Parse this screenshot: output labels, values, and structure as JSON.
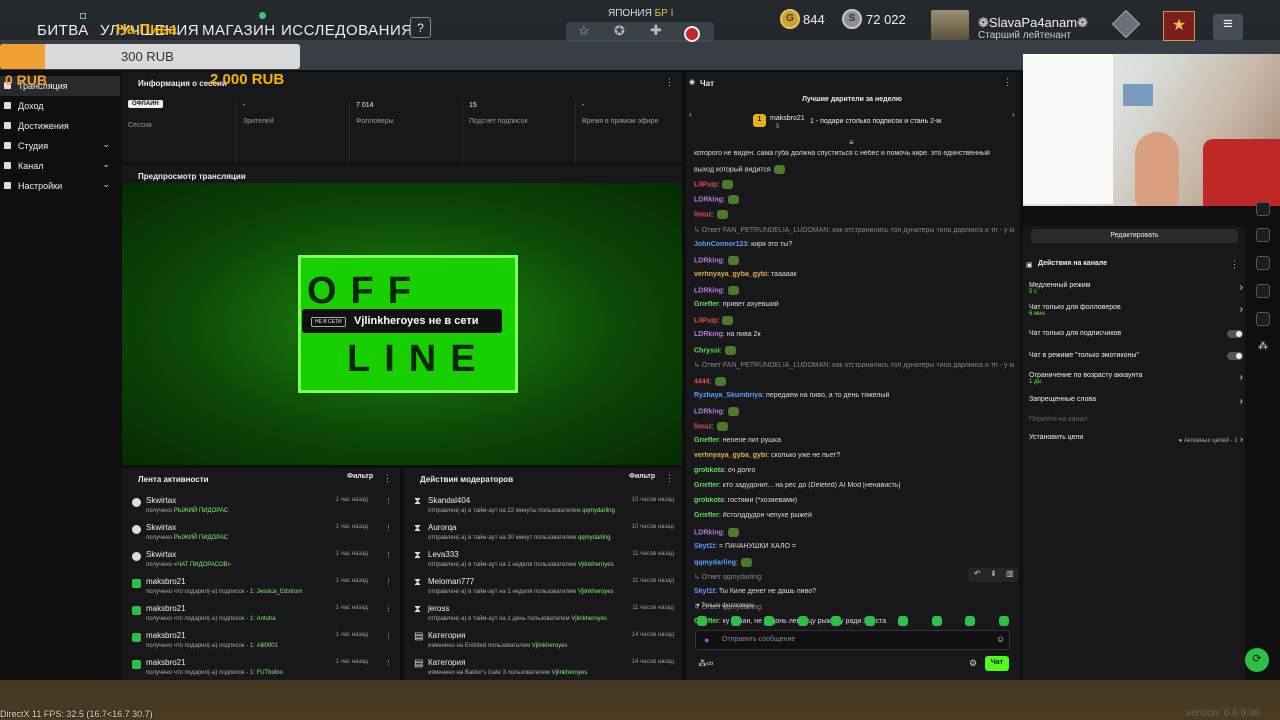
{
  "game": {
    "nav": [
      "БИТВА",
      "УЛУЧШЕНИЯ",
      "МАГАЗИН",
      "ИССЛЕДОВАНИЯ"
    ],
    "help": "?",
    "nation": "ЯПОНИЯ",
    "nation_tag": "БР І",
    "gold": "844",
    "silver": "72 022",
    "player": "❁SlavaPa4anam❁",
    "rank": "Старший лейтенант",
    "fps": "DirectX 11 FPS: 32.5 (16.7<16.7 30.7)",
    "version": "version: 0.6.9.98"
  },
  "donation": {
    "goal": "300 RUB",
    "current": "0 RUB",
    "overlay_title": "На Пива",
    "overlay_amount": "2 000 RUB",
    "progress": 0.0
  },
  "sidebar": {
    "items": [
      {
        "label": "Трансляция",
        "chev": false
      },
      {
        "label": "Доход",
        "chev": false
      },
      {
        "label": "Достижения",
        "chev": false
      },
      {
        "label": "Студия",
        "chev": true
      },
      {
        "label": "Канал",
        "chev": true
      },
      {
        "label": "Настройки",
        "chev": true
      }
    ]
  },
  "session": {
    "title": "Информация о сессии",
    "badge": "ОФЛАЙН",
    "stats": [
      {
        "value": "",
        "label": "Сессия"
      },
      {
        "value": "-",
        "label": "Зрителей"
      },
      {
        "value": "7 014",
        "label": "Фолловеры"
      },
      {
        "value": "15",
        "label": "Подсчет подписок"
      },
      {
        "value": "-",
        "label": "Время в прямом эфире"
      }
    ]
  },
  "preview": {
    "title": "Предпросмотр трансляции",
    "offline_top": "OFF",
    "offline_bottom": "LINE",
    "status_tag": "НЕ В СЕТИ",
    "status_text": "Vjlinkheroyes не в сети"
  },
  "activity": {
    "title": "Лента активности",
    "filter": "Фильтр",
    "rows": [
      {
        "name": "Skwirtax",
        "desc_a": "получено ",
        "desc_b": "РЫЖИЙ ПИДОРАС",
        "desc_c": "",
        "time": "1 час назад",
        "kind": "points"
      },
      {
        "name": "Skwirtax",
        "desc_a": "получено ",
        "desc_b": "РЫЖИЙ ПИДОРАС",
        "desc_c": "",
        "time": "1 час назад",
        "kind": "points"
      },
      {
        "name": "Skwirtax",
        "desc_a": "получено ",
        "desc_b": "«ЧАТ ПИДОРАСОВ»",
        "desc_c": "",
        "time": "1 час назад",
        "kind": "points"
      },
      {
        "name": "maksbro21",
        "desc_a": "получено что подарил(-а) подписок - ",
        "desc_b": "1",
        "desc_c": ": Jessica_Edstrom",
        "time": "1 час назад",
        "kind": "gift"
      },
      {
        "name": "maksbro21",
        "desc_a": "получено что подарил(-а) подписок - ",
        "desc_b": "1",
        "desc_c": ": Antuha",
        "time": "1 час назад",
        "kind": "gift"
      },
      {
        "name": "maksbro21",
        "desc_a": "получено что подарил(-а) подписок - ",
        "desc_b": "1",
        "desc_c": ": Alil0001",
        "time": "1 час назад",
        "kind": "gift"
      },
      {
        "name": "maksbro21",
        "desc_a": "получено что подарил(-а) подписок - ",
        "desc_b": "1",
        "desc_c": ": FUTbolno",
        "time": "1 час назад",
        "kind": "gift"
      }
    ]
  },
  "modactions": {
    "title": "Действия модераторов",
    "filter": "Фильтр",
    "rows": [
      {
        "name": "Skandal404",
        "desc_a": "отправлен(-а) в тайм-аут на 22 минуты пользователем ",
        "desc_b": "qqmydarling",
        "time": "10 часов назад",
        "kind": "timeout"
      },
      {
        "name": "Aurorqa",
        "desc_a": "отправлен(-а) в тайм-аут на 30 минут пользователем ",
        "desc_b": "qqmydarling",
        "time": "10 часов назад",
        "kind": "timeout"
      },
      {
        "name": "Leva333",
        "desc_a": "отправлен(-а) в тайм-аут на 1 неделя пользователем ",
        "desc_b": "Vjlinkheroyes",
        "time": "11 часов назад",
        "kind": "timeout"
      },
      {
        "name": "Meloman777",
        "desc_a": "отправлен(-а) в тайм-аут на 1 неделя пользователем ",
        "desc_b": "Vjlinkheroyes",
        "time": "11 часов назад",
        "kind": "timeout"
      },
      {
        "name": "jeross",
        "desc_a": "отправлен(-а) в тайм-аут на 1 день пользователем ",
        "desc_b": "Vjlinkheroyes",
        "time": "11 часов назад",
        "kind": "timeout"
      },
      {
        "name": "Категория",
        "desc_a": "изменено на Enlisted пользователем ",
        "desc_b": "Vjlinkheroyes",
        "time": "14 часов назад",
        "kind": "category"
      },
      {
        "name": "Категория",
        "desc_a": "изменено на Baldur's Gate 3 пользователем ",
        "desc_b": "Vjlinkheroyes",
        "time": "14 часов назад",
        "kind": "category"
      }
    ]
  },
  "chat": {
    "title": "Чат",
    "top_title": "Лучшие дарители за неделю",
    "top_rank": "1",
    "top_name": "maksbro21",
    "top_count": "5",
    "top_hint": "1 - подари столько подписок и стань 2-м",
    "lines": [
      {
        "user": "",
        "color": "#ddd",
        "text": "которого не виден. сама губа должна спуститься с небес и помочь кире. это единственный"
      },
      {
        "user": "",
        "color": "#ddd",
        "text": "выход который видится"
      },
      {
        "user": "LilPuip",
        "color": "#e05050",
        "text": ":"
      },
      {
        "user": "LDRking",
        "color": "#b07de0",
        "text": ":"
      },
      {
        "user": "limuz",
        "color": "#e05050",
        "text": ":"
      },
      {
        "user": "",
        "color": "#888",
        "text": "↳ Ответ FAN_PETRUNDELIA_LUDOMAN: как отстранились топ дунатеры типа дарлинга и тп - у киры д..."
      },
      {
        "user": "JohnConnor123",
        "color": "#5aa0ff",
        "text": ": киря это ты?"
      },
      {
        "user": "LDRking",
        "color": "#b07de0",
        "text": ":"
      },
      {
        "user": "verhnyaya_gyba_gybi",
        "color": "#e0b050",
        "text": ": тааааак"
      },
      {
        "user": "LDRking",
        "color": "#b07de0",
        "text": ":"
      },
      {
        "user": "Griefler",
        "color": "#5ae05a",
        "text": ": привет ахуевший"
      },
      {
        "user": "LilPuip",
        "color": "#e05050",
        "text": ":"
      },
      {
        "user": "LDRking",
        "color": "#b07de0",
        "text": ": на пива 2к"
      },
      {
        "user": "Chryssi",
        "color": "#5ae05a",
        "text": ":"
      },
      {
        "user": "",
        "color": "#888",
        "text": "↳ Ответ FAN_PETRUNDELIA_LUDOMAN: как отстранились топ дунатеры типа дарлинга и тп - у киры д..."
      },
      {
        "user": "4444",
        "color": "#e05050",
        "text": ":"
      },
      {
        "user": "Ryzhaya_Skumbriya",
        "color": "#5aa0ff",
        "text": ": передаем на пиво, а то день тяжелый"
      },
      {
        "user": "LDRking",
        "color": "#b07de0",
        "text": ":"
      },
      {
        "user": "limuz",
        "color": "#e05050",
        "text": ":"
      },
      {
        "user": "Griefler",
        "color": "#5ae05a",
        "text": ": нenene пит рушка"
      },
      {
        "user": "verhnyaya_gyba_gybi",
        "color": "#e0b050",
        "text": ": сколько уже не пьет?"
      },
      {
        "user": "grobkota",
        "color": "#5ae05a",
        "text": ": оч долго"
      },
      {
        "user": "Griefler",
        "color": "#5ae05a",
        "text": ": кто задудонит... на рес до (Deleted) AI Mod [ненависть]"
      },
      {
        "user": "grobkota",
        "color": "#5ae05a",
        "text": ": гостями (*хозяевами)"
      },
      {
        "user": "Griefler",
        "color": "#5ae05a",
        "text": ": #столддудон чепухе рыжей"
      },
      {
        "user": "LDRking",
        "color": "#b07de0",
        "text": ":"
      },
      {
        "user": "Skyt1t",
        "color": "#5aa0ff",
        "text": ": = ПАЧАНУШКИ ХАЛО ="
      },
      {
        "user": "qqmydarling",
        "color": "#5aa0ff",
        "text": ":"
      },
      {
        "user": "",
        "color": "#888",
        "text": "↳ Ответ qqmydarling:"
      },
      {
        "user": "Skyt1t",
        "color": "#5aa0ff",
        "text": ": Ты Киле денег не дашь пиво?"
      },
      {
        "user": "",
        "color": "#888",
        "text": "↳ Ответ qqmydarling:"
      },
      {
        "user": "Griefler",
        "color": "#5ae05a",
        "text": ": ку пачан, не дудонь ленивцу рыжему ради Христа"
      }
    ],
    "followers_only": "Только фолловеры",
    "input_placeholder": "Отправить сообщение",
    "send": "Чат"
  },
  "channel": {
    "edit": "Редактировать",
    "actions_title": "Действия на канале",
    "rows": [
      {
        "label": "Медленный режим",
        "sub": "5 с",
        "ctrl": "chev"
      },
      {
        "label": "Чат только для фолловеров",
        "sub": "6 мин",
        "ctrl": "chev"
      },
      {
        "label": "Чат только для подписчиков",
        "sub": "",
        "ctrl": "toggle"
      },
      {
        "label": "Чат в режиме \"только эмотиконы\"",
        "sub": "",
        "ctrl": "toggle"
      },
      {
        "label": "Ограничение по возрасту аккаунта",
        "sub": "1 дн.",
        "ctrl": "chev"
      },
      {
        "label": "Запрещенные слова",
        "sub": "",
        "ctrl": "chev"
      },
      {
        "label": "Перейти на канал",
        "sub": "",
        "ctrl": "none"
      },
      {
        "label": "Установить цели",
        "sub": "",
        "ctrl": "goals"
      }
    ],
    "goals_status": "Активных целей - 1"
  },
  "colors": {
    "accent": "#53fc18",
    "panel": "#18181a",
    "bg": "#0f0f10"
  }
}
